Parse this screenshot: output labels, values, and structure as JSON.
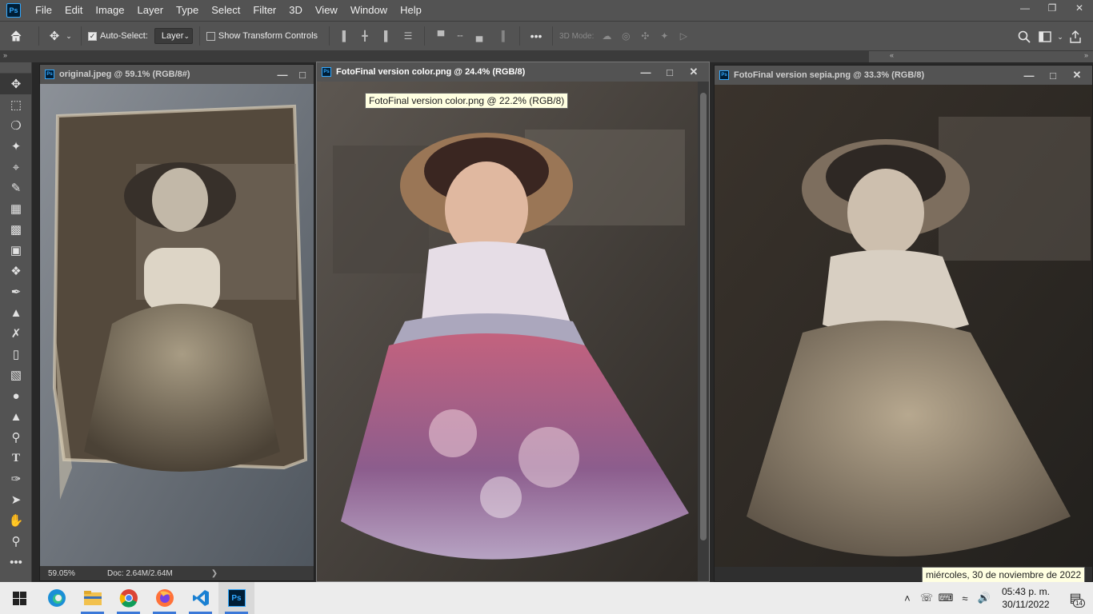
{
  "app": {
    "logo": "Ps"
  },
  "menu": [
    "File",
    "Edit",
    "Image",
    "Layer",
    "Type",
    "Select",
    "Filter",
    "3D",
    "View",
    "Window",
    "Help"
  ],
  "options_bar": {
    "auto_select_label": "Auto-Select:",
    "auto_select_checked": true,
    "layer_select_value": "Layer",
    "show_transform_label": "Show Transform Controls",
    "show_transform_checked": false,
    "mode_3d_label": "3D Mode:"
  },
  "documents": {
    "original": {
      "title": "original.jpeg @ 59.1% (RGB/8#)",
      "zoom": "59.05%",
      "doc_size": "Doc: 2.64M/2.64M"
    },
    "color": {
      "title": "FotoFinal version color.png @ 24.4% (RGB/8)",
      "tooltip": "FotoFinal version color.png @ 22.2% (RGB/8)"
    },
    "sepia": {
      "title": "FotoFinal version sepia.png @ 33.3% (RGB/8)"
    }
  },
  "taskbar": {
    "time": "05:43 p. m.",
    "date": "30/11/2022",
    "date_tooltip": "miércoles, 30 de noviembre de 2022",
    "notification_count": "14"
  },
  "colors": {
    "ps_blue": "#31a8ff",
    "panel": "#535353",
    "canvas_bg": "#282828",
    "taskbar": "#ececec"
  }
}
